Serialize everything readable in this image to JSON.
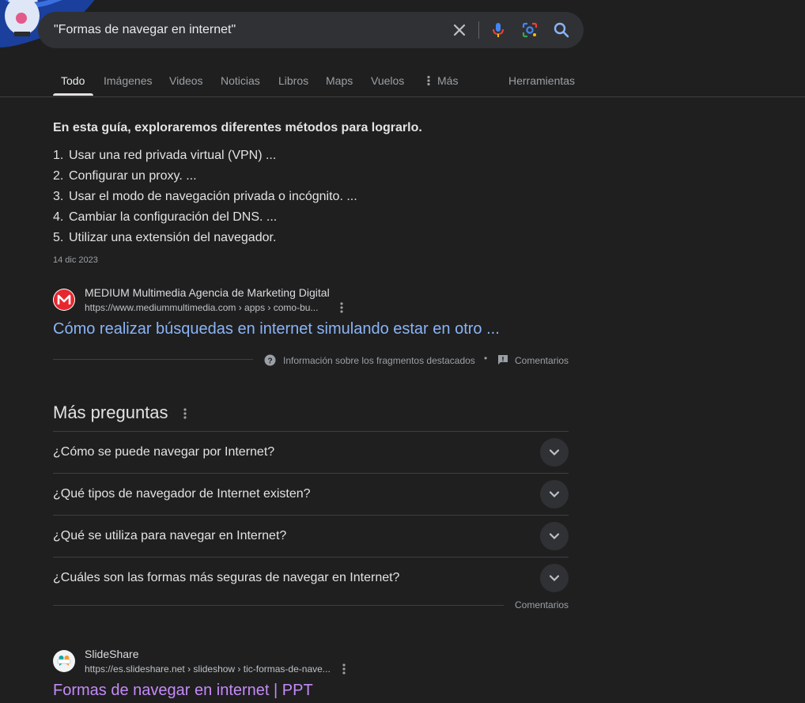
{
  "search": {
    "query": "\"Formas de navegar en internet\"",
    "icons": [
      "clear-icon",
      "mic-icon",
      "lens-icon",
      "search-icon"
    ]
  },
  "tabs": {
    "items": [
      {
        "label": "Todo",
        "active": true
      },
      {
        "label": "Imágenes"
      },
      {
        "label": "Videos"
      },
      {
        "label": "Noticias"
      },
      {
        "label": "Libros"
      },
      {
        "label": "Maps"
      },
      {
        "label": "Vuelos"
      },
      {
        "label": "Más"
      }
    ],
    "tools_label": "Herramientas"
  },
  "featured": {
    "heading": "En esta guía, exploraremos diferentes métodos para lograrlo.",
    "list": [
      {
        "num": "1.",
        "text": "Usar una red privada virtual (VPN) ..."
      },
      {
        "num": "2.",
        "text": "Configurar un proxy. ..."
      },
      {
        "num": "3.",
        "text": "Usar el modo de navegación privada o incógnito. ..."
      },
      {
        "num": "4.",
        "text": "Cambiar la configuración del DNS. ..."
      },
      {
        "num": "5.",
        "text": "Utilizar una extensión del navegador."
      }
    ],
    "date": "14 dic 2023",
    "source": {
      "name": "MEDIUM Multimedia Agencia de Marketing Digital",
      "url": "https://www.mediummultimedia.com › apps › como-bu...",
      "title": "Cómo realizar búsquedas en internet simulando estar en otro ..."
    },
    "about_label": "Información sobre los fragmentos destacados",
    "separator": "•",
    "feedback_label": "Comentarios"
  },
  "paa": {
    "title": "Más preguntas",
    "questions": [
      "¿Cómo se puede navegar por Internet?",
      "¿Qué tipos de navegador de Internet existen?",
      "¿Qué se utiliza para navegar en Internet?",
      "¿Cuáles son las formas más seguras de navegar en Internet?"
    ],
    "feedback_label": "Comentarios"
  },
  "result2": {
    "name": "SlideShare",
    "url": "https://es.slideshare.net › slideshow › tic-formas-de-nave...",
    "title": "Formas de navegar en internet | PPT"
  },
  "colors": {
    "background": "#1f1f1f",
    "link_blue": "#8ab4f8",
    "link_visited": "#c58af9",
    "medium_red": "#e8262f"
  }
}
